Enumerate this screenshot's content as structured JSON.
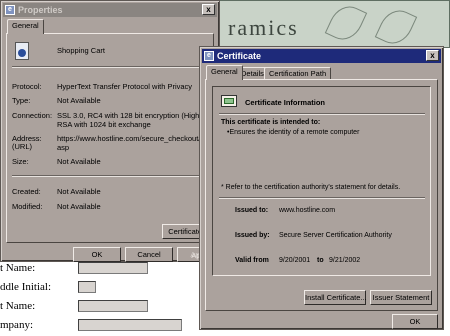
{
  "background_page": {
    "banner_text": "ramics",
    "left_fragments": [
      "i",
      "o",
      "S",
      "a",
      "L",
      "n",
      "i"
    ],
    "form_labels": [
      "t Name:",
      "ddle Initial:",
      "t Name:",
      "mpany:"
    ]
  },
  "properties_window": {
    "title": "Properties",
    "close_label": "x",
    "tab_general": "General",
    "item_name": "Shopping Cart",
    "rows": [
      {
        "label": "Protocol:",
        "value": "HyperText Transfer Protocol with Privacy"
      },
      {
        "label": "Type:",
        "value": "Not Available"
      },
      {
        "label": "Connection:",
        "value": "SSL 3.0, RC4 with 128 bit encryption (High); RSA with 1024 bit exchange"
      },
      {
        "label": "Address:",
        "label2": "(URL)",
        "value": "https://www.hostline.com/secure_checkout/defa asp"
      },
      {
        "label": "Size:",
        "value": "Not Available"
      },
      {
        "label": "Created:",
        "value": "Not Available"
      },
      {
        "label": "Modified:",
        "value": "Not Available"
      }
    ],
    "certificates_button": "Certificates",
    "ok_button": "OK",
    "cancel_button": "Cancel",
    "apply_button": "App"
  },
  "certificate_window": {
    "title": "Certificate",
    "close_label": "x",
    "tabs": [
      "General",
      "Details",
      "Certification Path"
    ],
    "info_heading": "Certificate Information",
    "intended_heading": "This certificate is intended to:",
    "intended_item": "•Ensures the identity of a remote computer",
    "refer_note": "* Refer to the certification authority's statement for details.",
    "issued_to_label": "Issued to:",
    "issued_to_value": "www.hostline.com",
    "issued_by_label": "Issued by:",
    "issued_by_value": "Secure Server Certification Authority",
    "valid_from_label": "Valid from",
    "valid_from_value": "9/20/2001",
    "valid_to_label": "to",
    "valid_to_value": "9/21/2002",
    "install_button": "Install Certificate...",
    "issuer_button": "Issuer Statement",
    "ok_button": "OK"
  },
  "colors": {
    "dialog_face": "#aba29d",
    "active_title": "#1e2a7a",
    "inactive_title": "#8a8581",
    "banner_bg": "#c9d3c8"
  }
}
